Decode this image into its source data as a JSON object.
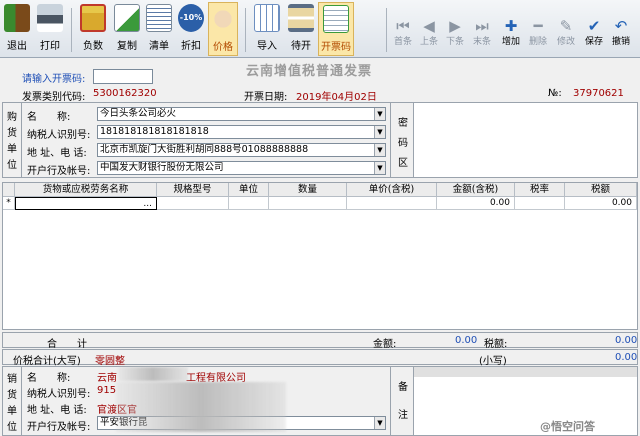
{
  "toolbar": {
    "buttons": [
      {
        "label": "退出"
      },
      {
        "label": "打印"
      },
      {
        "label": "负数"
      },
      {
        "label": "复制"
      },
      {
        "label": "清单"
      },
      {
        "label": "折扣"
      },
      {
        "label": "价格"
      },
      {
        "label": "导入"
      },
      {
        "label": "待开"
      },
      {
        "label": "开票码"
      }
    ],
    "discount_badge": "-10%",
    "nav": [
      {
        "label": "首条"
      },
      {
        "label": "上条"
      },
      {
        "label": "下条"
      },
      {
        "label": "末条"
      },
      {
        "label": "增加"
      },
      {
        "label": "删除"
      },
      {
        "label": "修改"
      },
      {
        "label": "保存"
      },
      {
        "label": "撤销"
      }
    ]
  },
  "invoice": {
    "title": "云南增值税普通发票",
    "code_prompt": "请输入开票码:",
    "type_code_label": "发票类别代码:",
    "type_code": "5300162320",
    "date_label": "开票日期:",
    "date": "2019年04月02日",
    "no_label": "№:",
    "no": "37970621"
  },
  "buyer": {
    "side_label": [
      "购",
      "货",
      "单",
      "位"
    ],
    "name_label": "名　　称:",
    "name": "今日头条公司必火",
    "tax_label": "纳税人识别号:",
    "tax_id": "181818181818181818",
    "addr_label": "地 址、电 话:",
    "addr": "北京市凯旋门大街胜利胡同888号01088888888",
    "bank_label": "开户行及帐号:",
    "bank": "中国发大财银行股份无限公司",
    "password_label": [
      "密",
      "码",
      "区"
    ]
  },
  "grid": {
    "headers": [
      "货物或应税劳务名称",
      "规格型号",
      "单位",
      "数量",
      "单价(含税)",
      "金额(含税)",
      "税率",
      "税额"
    ],
    "row_marker": "*",
    "ellipsis": "...",
    "amount": "0.00",
    "tax": "0.00"
  },
  "totals": {
    "label": "合　　计",
    "amount_label": "金额:",
    "amount": "0.00",
    "tax_label": "税额:",
    "tax": "0.00",
    "total_label": "价税合计(大写)",
    "total_upper": "零圆整",
    "small_label": "(小写)",
    "small": "0.00"
  },
  "seller": {
    "side_label": [
      "销",
      "货",
      "单",
      "位"
    ],
    "name_label": "名　　称:",
    "name_start": "云南",
    "name_end": "工程有限公司",
    "tax_label": "纳税人识别号:",
    "tax_start": "915",
    "addr_label": "地 址、电 话:",
    "addr_start": "官渡区官",
    "bank_label": "开户行及帐号:",
    "bank_start": "平安银行昆",
    "remark_label": [
      "备",
      "注"
    ]
  },
  "watermark": "@悟空问答"
}
